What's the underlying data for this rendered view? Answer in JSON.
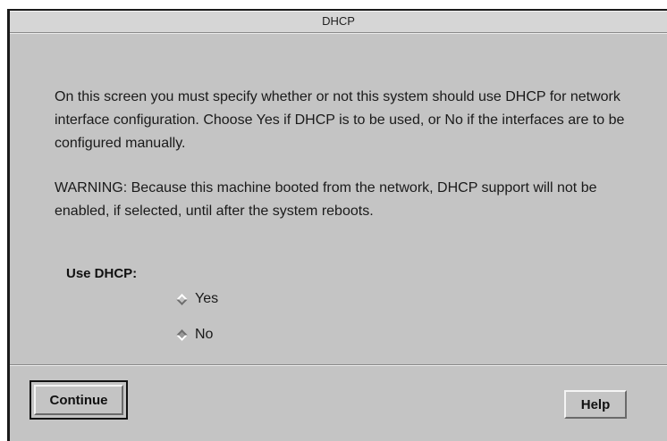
{
  "window": {
    "title": "DHCP"
  },
  "content": {
    "paragraph1": "On this screen you must specify whether or not this system should use DHCP for network interface configuration.  Choose Yes if DHCP is to be used, or No if the interfaces are to be configured manually.",
    "paragraph2": "WARNING: Because this machine booted from the network, DHCP support will not be enabled, if selected, until after the system reboots."
  },
  "dhcp": {
    "label": "Use DHCP:",
    "options": [
      {
        "label": "Yes",
        "selected": false
      },
      {
        "label": "No",
        "selected": true
      }
    ]
  },
  "buttons": {
    "continue_label": "Continue",
    "help_label": "Help"
  }
}
